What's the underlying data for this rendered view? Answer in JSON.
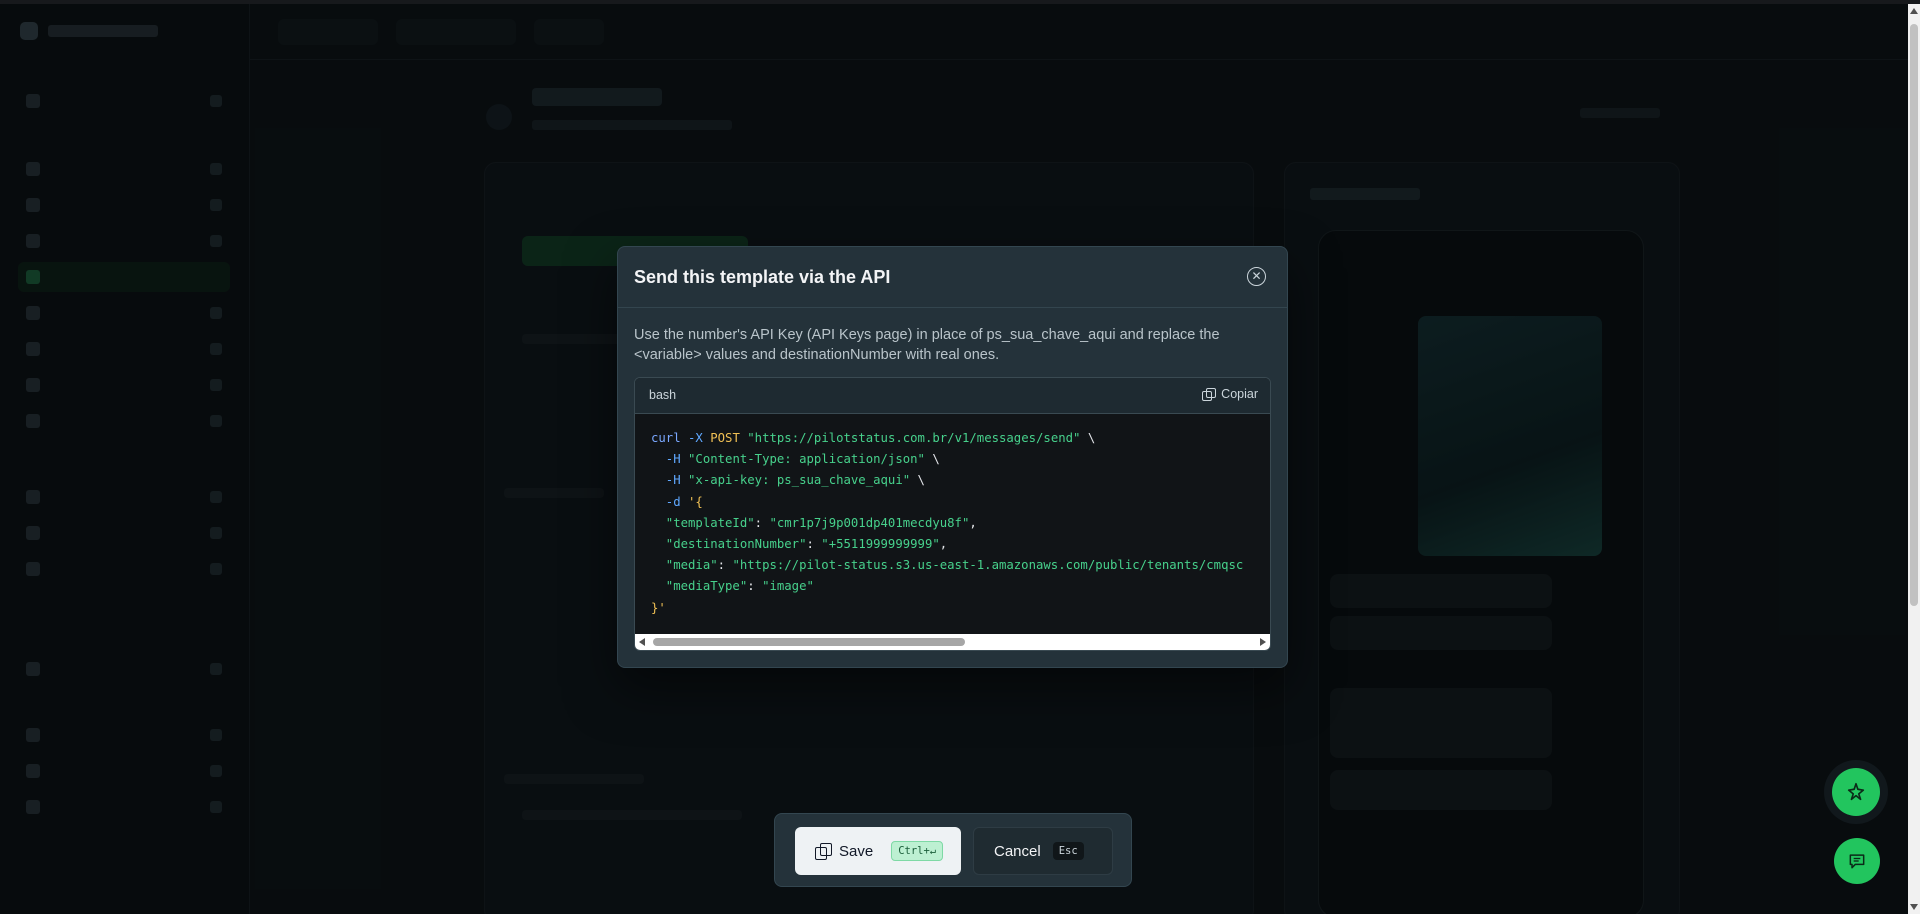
{
  "modal": {
    "title": "Send this template via the API",
    "description": "Use the number's API Key (API Keys page) in place of ps_sua_chave_aqui and replace the <variable> values and destinationNumber with real ones.",
    "code": {
      "language": "bash",
      "copy_label": "Copiar",
      "lines": [
        [
          {
            "t": "curl",
            "c": "cmd"
          },
          {
            "t": " -X ",
            "c": "flag"
          },
          {
            "t": "POST",
            "c": "kw"
          },
          {
            "t": " ",
            "c": "plain"
          },
          {
            "t": "\"https://pilotstatus.com.br/v1/messages/send\"",
            "c": "str"
          },
          {
            "t": " \\",
            "c": "plain"
          }
        ],
        [
          {
            "t": "  -H ",
            "c": "flag"
          },
          {
            "t": "\"Content-Type: application/json\"",
            "c": "str"
          },
          {
            "t": " \\",
            "c": "plain"
          }
        ],
        [
          {
            "t": "  -H ",
            "c": "flag"
          },
          {
            "t": "\"x-api-key: ps_sua_chave_aqui\"",
            "c": "str"
          },
          {
            "t": " \\",
            "c": "plain"
          }
        ],
        [
          {
            "t": "  -d ",
            "c": "flag"
          },
          {
            "t": "'{",
            "c": "brace"
          }
        ],
        [
          {
            "t": "  \"templateId\"",
            "c": "str"
          },
          {
            "t": ": ",
            "c": "plain"
          },
          {
            "t": "\"cmr1p7j9p001dp401mecdyu8f\"",
            "c": "str"
          },
          {
            "t": ",",
            "c": "plain"
          }
        ],
        [
          {
            "t": "  \"destinationNumber\"",
            "c": "str"
          },
          {
            "t": ": ",
            "c": "plain"
          },
          {
            "t": "\"+5511999999999\"",
            "c": "str"
          },
          {
            "t": ",",
            "c": "plain"
          }
        ],
        [
          {
            "t": "  \"media\"",
            "c": "str"
          },
          {
            "t": ": ",
            "c": "plain"
          },
          {
            "t": "\"https://pilot-status.s3.us-east-1.amazonaws.com/public/tenants/cmqsc",
            "c": "str"
          }
        ],
        [
          {
            "t": "  \"mediaType\"",
            "c": "str"
          },
          {
            "t": ": ",
            "c": "plain"
          },
          {
            "t": "\"image\"",
            "c": "str"
          }
        ],
        [
          {
            "t": "}'",
            "c": "brace"
          }
        ]
      ]
    }
  },
  "actions": {
    "save_label": "Save",
    "save_shortcut": "Ctrl+↵",
    "cancel_label": "Cancel",
    "cancel_shortcut": "Esc"
  },
  "colors": {
    "accent": "#22c55e",
    "modal_bg": "#24323a",
    "code_bg": "#111417"
  }
}
